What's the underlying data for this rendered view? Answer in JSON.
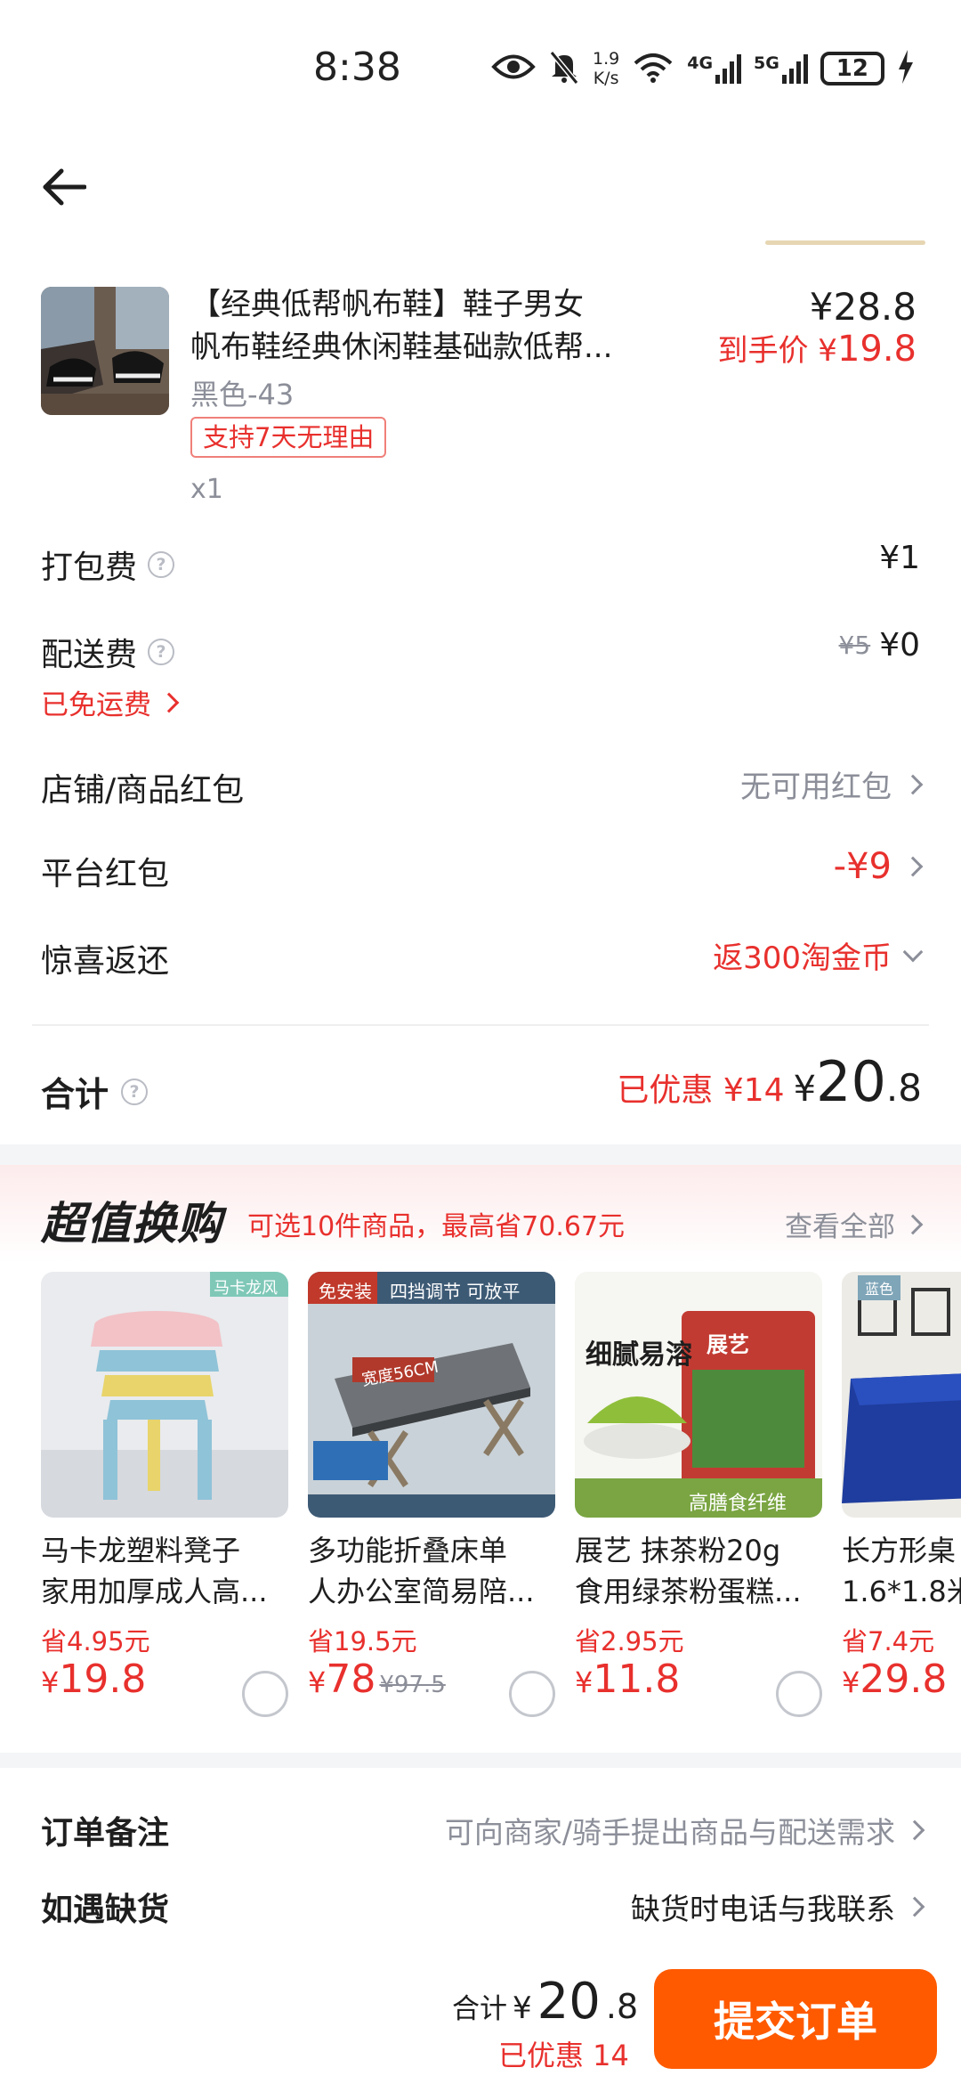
{
  "status_bar": {
    "time": "8:38",
    "net_speed_value": "1.9",
    "net_speed_unit": "K/s",
    "signal_1": "4G",
    "signal_2": "5G",
    "battery": "12",
    "icons": [
      "eye-icon",
      "bell-muted-icon",
      "wifi-icon",
      "signal-icon",
      "signal-icon",
      "battery-icon",
      "charging-icon"
    ]
  },
  "nav": {
    "back_icon": "arrow-left-icon"
  },
  "product": {
    "title_line1": "【经典低帮帆布鞋】鞋子男女",
    "title_line2": "帆布鞋经典休闲鞋基础款低帮...",
    "price": "¥28.8",
    "final_price_label": "到手价",
    "final_price_currency": "¥",
    "final_price": "19.8",
    "variant": "黑色-43",
    "return_tag": "支持7天无理由",
    "quantity": "x1"
  },
  "fees": {
    "packing_label": "打包费",
    "packing_value": "¥1",
    "delivery_label": "配送费",
    "delivery_orig": "¥5",
    "delivery_value": "¥0",
    "free_shipping": "已免运费"
  },
  "coupons": {
    "store_label": "店铺/商品红包",
    "store_value": "无可用红包",
    "platform_label": "平台红包",
    "platform_value": "-¥9",
    "surprise_label": "惊喜返还",
    "surprise_value": "返300淘金币"
  },
  "total": {
    "label": "合计",
    "saved": "已优惠 ¥14",
    "currency": "¥",
    "amount_int": "20",
    "amount_dec": ".8"
  },
  "deals": {
    "title": "超值换购",
    "subtitle": "可选10件商品，最高省70.67元",
    "view_all": "查看全部",
    "items": [
      {
        "name_line1": "马卡龙塑料凳子",
        "name_line2": "家用加厚成人高...",
        "save": "省4.95元",
        "currency": "¥",
        "price": "19.8",
        "orig": "",
        "tag": "马卡龙风"
      },
      {
        "name_line1": "多功能折叠床单",
        "name_line2": "人办公室简易陪...",
        "save": "省19.5元",
        "currency": "¥",
        "price": "78",
        "orig": "¥97.5",
        "tag": "免安装",
        "tag2": "四挡调节 可放平",
        "tag3": "宽度56CM"
      },
      {
        "name_line1": "展艺 抹茶粉20g",
        "name_line2": "食用绿茶粉蛋糕...",
        "save": "省2.95元",
        "currency": "¥",
        "price": "11.8",
        "orig": "",
        "tag": "细腻易溶",
        "tag2": "展艺",
        "tag3": "高膳食纤维"
      },
      {
        "name_line1": "长方形桌",
        "name_line2": "1.6*1.8米",
        "save": "省7.4元",
        "currency": "¥",
        "price": "29.8",
        "orig": "",
        "tag": "蓝色"
      }
    ]
  },
  "notes": {
    "remark_label": "订单备注",
    "remark_value": "可向商家/骑手提出商品与配送需求",
    "stockout_label": "如遇缺货",
    "stockout_value": "缺货时电话与我联系"
  },
  "bottom": {
    "total_label": "合计",
    "currency": "¥",
    "amount_int": "20",
    "amount_dec": ".8",
    "saved": "已优惠 14",
    "submit": "提交订单"
  },
  "colors": {
    "accent_red": "#e8302d",
    "submit_orange": "#ff5a00",
    "muted_gray": "#8c8f99"
  }
}
